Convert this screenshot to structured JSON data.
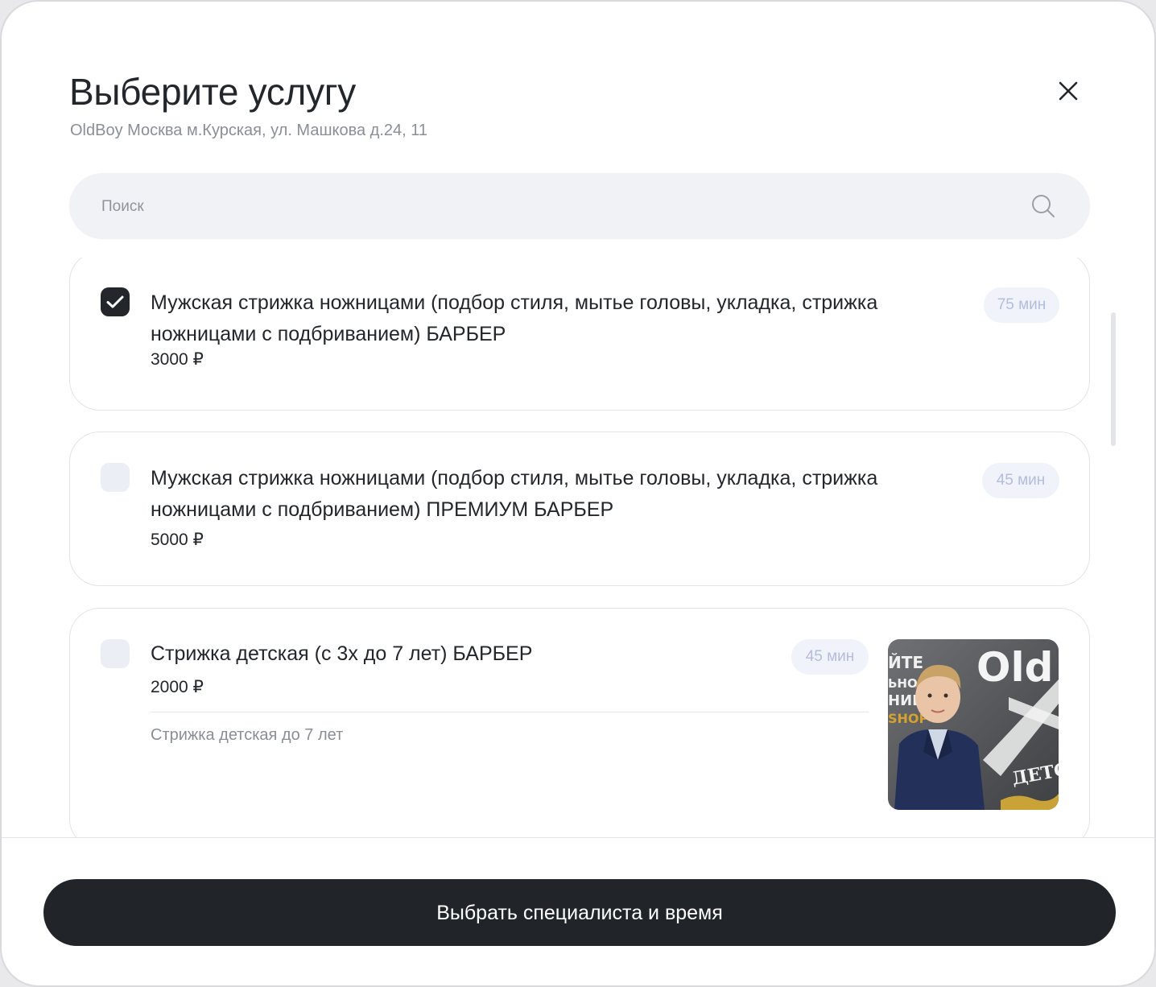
{
  "header": {
    "title": "Выберите услугу",
    "address": "OldBoy Москва м.Курская, ул. Машкова д.24, 11",
    "close_icon": "close-icon"
  },
  "search": {
    "placeholder": "Поиск",
    "value": "",
    "icon": "search-icon"
  },
  "services": [
    {
      "name": "Мужская стрижка ножницами (подбор стиля, мытье головы, укладка, стрижка ножницами с подбриванием) БАРБЕР",
      "price": "3000 ₽",
      "duration": "75 мин",
      "checked": true
    },
    {
      "name": "Мужская стрижка ножницами (подбор стиля, мытье головы, укладка, стрижка ножницами с подбриванием) ПРЕМИУМ БАРБЕР",
      "price": "5000 ₽",
      "duration": "45 мин",
      "checked": false
    },
    {
      "name": "Стрижка детская (с 3х до 7 лет) БАРБЕР",
      "price": "2000 ₽",
      "duration": "45 мин",
      "description": "Стрижка детская до 7 лет",
      "checked": false,
      "thumbnail_text": {
        "left_lines": [
          "ЙТЕ",
          "ЬНОЕ",
          "НИЕ",
          "SHOP"
        ],
        "brand": "Old",
        "bottom": "ДЕТСІ"
      }
    }
  ],
  "footer": {
    "cta_label": "Выбрать специалиста и время"
  },
  "colors": {
    "primary_dark": "#212529",
    "duration_badge_bg": "#f1f3fa",
    "duration_badge_text": "#b4bce0",
    "checkbox_unchecked": "#eceef5",
    "muted_text": "#8a8f96"
  }
}
